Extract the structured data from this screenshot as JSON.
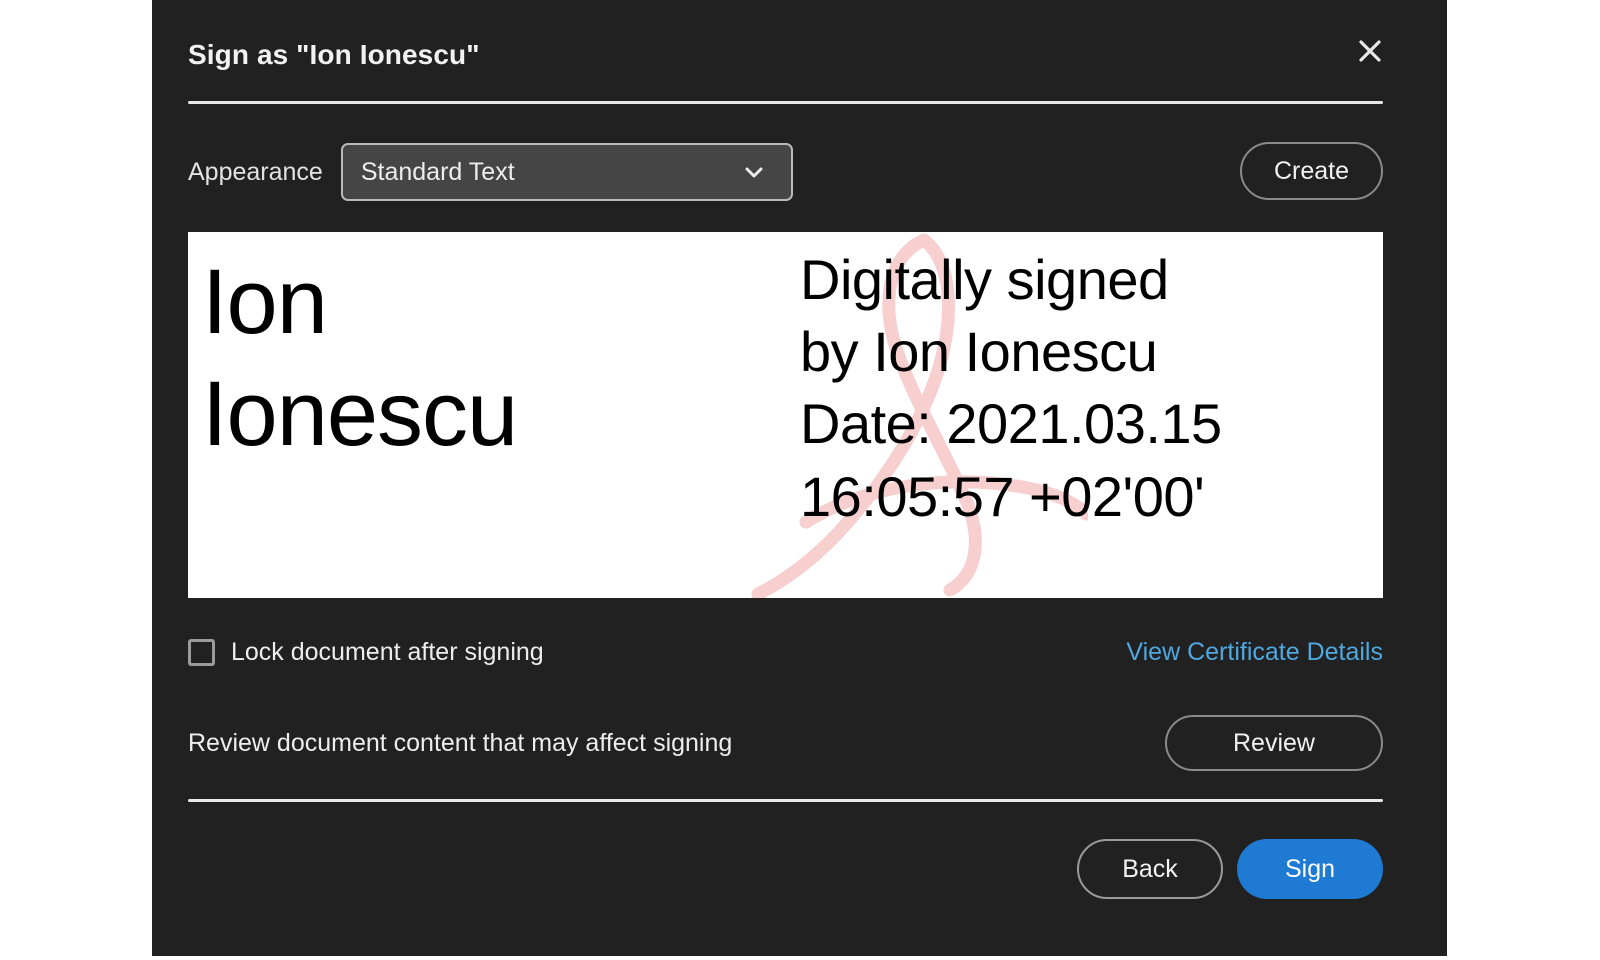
{
  "dialog": {
    "title": "Sign as \"Ion Ionescu\"",
    "close_icon": "close-icon"
  },
  "appearance": {
    "label": "Appearance",
    "selected_value": "Standard Text",
    "chevron_icon": "chevron-down-icon",
    "create_label": "Create"
  },
  "signature_preview": {
    "name_line_1": "Ion",
    "name_line_2": "Ionescu",
    "detail_line_1": "Digitally signed",
    "detail_line_2": "by Ion Ionescu",
    "detail_line_3": "Date: 2021.03.15",
    "detail_line_4": "16:05:57 +02'00'",
    "watermark_icon": "adobe-a-logo-watermark",
    "watermark_color": "#f7cfcf",
    "background_color": "#ffffff",
    "text_color": "#000000"
  },
  "lock_row": {
    "checkbox_label": "Lock document after signing",
    "checkbox_checked": false,
    "certificate_link": "View Certificate Details",
    "link_color": "#4fa8e0"
  },
  "review_row": {
    "text": "Review document content that may affect signing",
    "button_label": "Review"
  },
  "footer": {
    "back_label": "Back",
    "sign_label": "Sign",
    "sign_button_color": "#1f7ad4"
  },
  "theme": {
    "dialog_background": "#212121",
    "page_background": "#ffffff",
    "text_primary": "#ededed",
    "border_color": "#8a8a8a"
  }
}
